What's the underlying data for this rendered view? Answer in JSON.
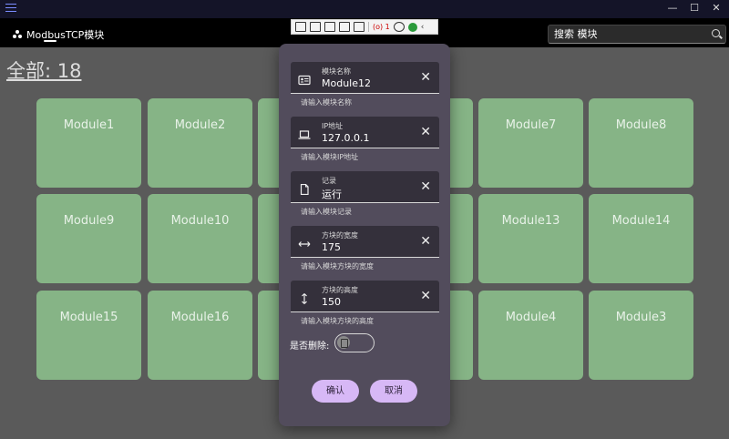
{
  "app": {
    "nav_tab": "ModbusTCP模块"
  },
  "window_controls": {
    "minimize": "—",
    "maximize": "☐",
    "close": "✕"
  },
  "devbar": {
    "count": "(o) 1",
    "chevron": "‹"
  },
  "search": {
    "value": "搜索 模块"
  },
  "summary": {
    "total": "全部: 18"
  },
  "tiles": [
    {
      "name": "Module1"
    },
    {
      "name": "Module2"
    },
    {
      "name": ""
    },
    {
      "name": ""
    },
    {
      "name": "Module7"
    },
    {
      "name": "Module8"
    },
    {
      "name": "Module9"
    },
    {
      "name": "Module10"
    },
    {
      "name": ""
    },
    {
      "name": ""
    },
    {
      "name": "Module13"
    },
    {
      "name": "Module14"
    },
    {
      "name": "Module15"
    },
    {
      "name": "Module16"
    },
    {
      "name": ""
    },
    {
      "name": ""
    },
    {
      "name": "Module4"
    },
    {
      "name": "Module3"
    }
  ],
  "dialog": {
    "fields": [
      {
        "icon": "id-card-icon",
        "label": "模块名称",
        "value": "Module12",
        "hint": "请输入模块名称",
        "clear": "✕"
      },
      {
        "icon": "laptop-icon",
        "label": "IP地址",
        "value": "127.0.0.1",
        "hint": "请输入模块IP地址",
        "clear": "✕"
      },
      {
        "icon": "document-icon",
        "label": "记录",
        "value": "运行",
        "hint": "请输入模块记录",
        "clear": "✕"
      },
      {
        "icon": "horizontal-arrows-icon",
        "label": "方块的宽度",
        "value": "175",
        "hint": "请输入模块方块的宽度",
        "clear": "✕"
      },
      {
        "icon": "vertical-arrows-icon",
        "label": "方块的高度",
        "value": "150",
        "hint": "请输入模块方块的高度",
        "clear": "✕"
      }
    ],
    "delete_label": "是否删除:",
    "delete_on": false,
    "confirm": "确认",
    "cancel": "取消"
  }
}
